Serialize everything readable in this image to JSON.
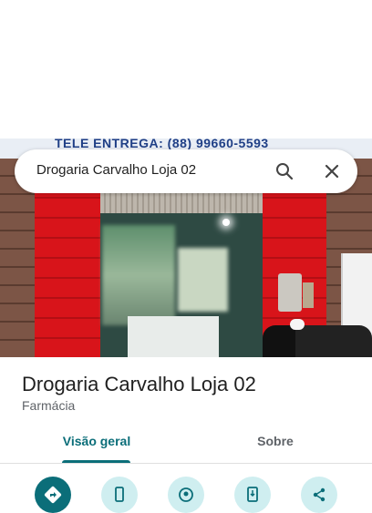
{
  "header_photo": {
    "sign_text": "TELE ENTREGA: (88) 99660-5593"
  },
  "search": {
    "query": "Drogaria Carvalho Loja 02"
  },
  "place": {
    "name": "Drogaria Carvalho Loja 02",
    "category": "Farmácia"
  },
  "tabs": [
    {
      "label": "Visão geral",
      "active": true
    },
    {
      "label": "Sobre",
      "active": false
    }
  ],
  "actions": [
    {
      "icon": "directions-icon",
      "primary": true
    },
    {
      "icon": "phone-icon",
      "primary": false
    },
    {
      "icon": "location-icon",
      "primary": false
    },
    {
      "icon": "save-to-phone-icon",
      "primary": false
    },
    {
      "icon": "share-icon",
      "primary": false
    }
  ],
  "colors": {
    "accent": "#0b6e79",
    "accent_light": "#cfeef0",
    "text_primary": "#1f1f1f",
    "text_secondary": "#5f6368"
  }
}
